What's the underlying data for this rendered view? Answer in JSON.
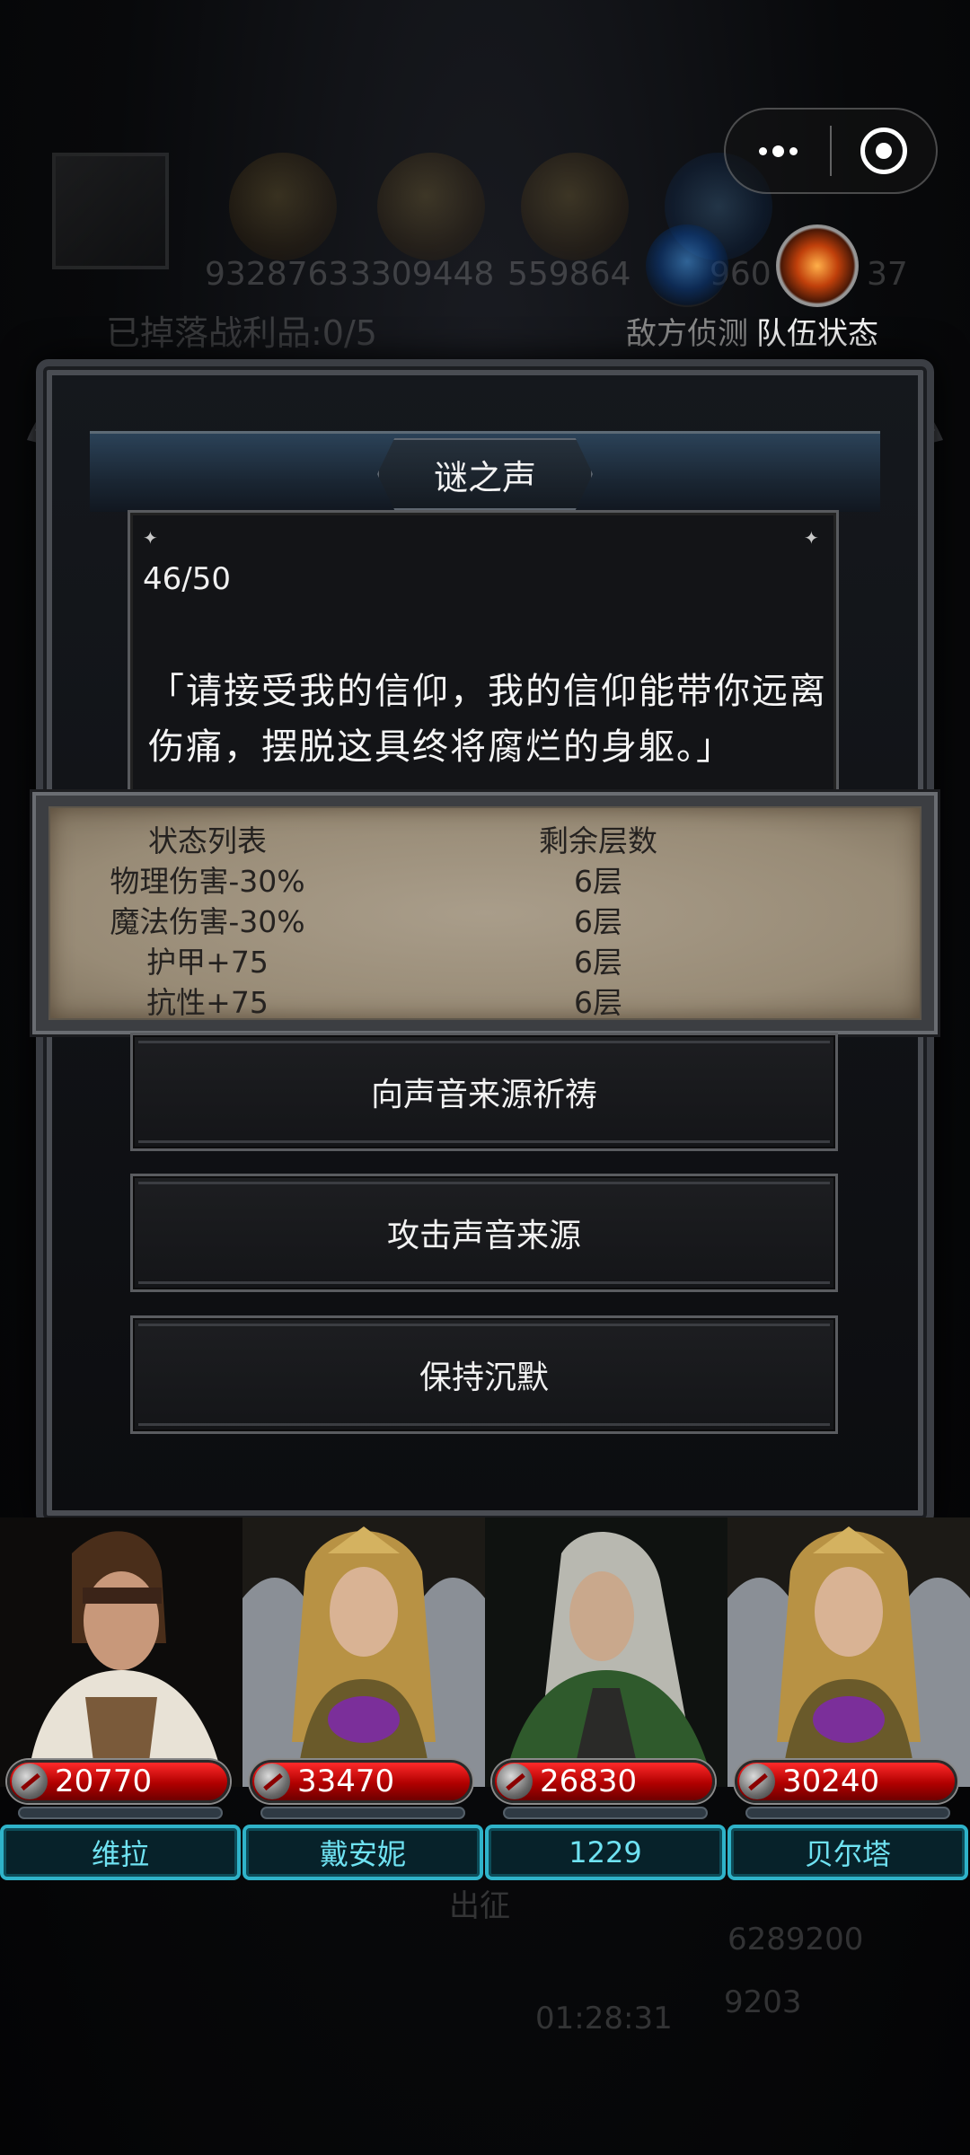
{
  "background": {
    "stats": [
      "9328763",
      "3309448",
      "559864",
      "960",
      "37"
    ],
    "loot": "已掉落战利品:0/5",
    "expedition": "出征",
    "gold": "6289200",
    "gems": "9203",
    "timer": "01:28:31"
  },
  "capsule": {
    "more_icon": "more-dots-icon",
    "close_icon": "target-circle-icon"
  },
  "hud": {
    "enemy_scout": "敌方侦测",
    "team_status": "队伍状态"
  },
  "dialog": {
    "title": "谜之声",
    "counter": "46/50",
    "story": "「请接受我的信仰，我的信仰能带你远离伤痛，摆脱这具终将腐烂的身躯。」"
  },
  "status_table": {
    "header": {
      "name": "状态列表",
      "stacks": "剩余层数"
    },
    "rows": [
      {
        "name": "物理伤害-30%",
        "stacks": "6层"
      },
      {
        "name": "魔法伤害-30%",
        "stacks": "6层"
      },
      {
        "name": "护甲+75",
        "stacks": "6层"
      },
      {
        "name": "抗性+75",
        "stacks": "6层"
      }
    ]
  },
  "options": [
    {
      "label": "向声音来源祈祷"
    },
    {
      "label": "攻击声音来源"
    },
    {
      "label": "保持沉默"
    }
  ],
  "heroes": [
    {
      "name": "维拉",
      "hp": "20770"
    },
    {
      "name": "戴安妮",
      "hp": "33470"
    },
    {
      "name": "1229",
      "hp": "26830"
    },
    {
      "name": "贝尔塔",
      "hp": "30240"
    }
  ],
  "colors": {
    "hp_red": "#d40000",
    "name_cyan": "#2fb3c9",
    "parchment": "#a99d8a"
  }
}
